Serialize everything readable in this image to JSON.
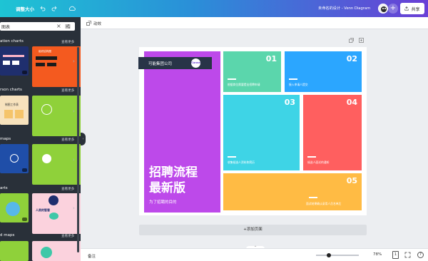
{
  "topbar": {
    "resize_label": "调整大小",
    "doc_title": "未命名的设计 - Venn Diagram",
    "share_label": "共享"
  },
  "sidebar": {
    "search_query": "图表",
    "sections": [
      {
        "title": "ation charts",
        "more": "查看更多"
      },
      {
        "title": "rson charts",
        "more": "查看更多"
      },
      {
        "title": "maps",
        "more": "查看更多"
      },
      {
        "title": "arts",
        "more": "查看更多"
      },
      {
        "title": "d maps",
        "more": "查看更多"
      }
    ],
    "thumb_texts": {
      "orgchart": "组织结构图",
      "compare": "制图工作表",
      "people": "人类的智慧"
    }
  },
  "canvas_toolbar": {
    "animate_label": "动效"
  },
  "slide": {
    "company": "可能集团公司",
    "logo_text": "Canva",
    "title_lines": [
      "招聘流程",
      "最新版"
    ],
    "subtitle": "为了招聘的目的",
    "tiles": [
      {
        "num": "01",
        "text": "根据岗位需要提出招聘申请"
      },
      {
        "num": "02",
        "text": "接入申请人提交"
      },
      {
        "num": "03",
        "text": "收集候选人资料和简历"
      },
      {
        "num": "04",
        "text": "候选人面试的通知"
      },
      {
        "num": "05",
        "text": "面试结果确认录用人员名单后"
      }
    ],
    "colors": {
      "purple": "#bd49ea",
      "tile1": "#5bd6ac",
      "tile2": "#2ba6ff",
      "tile3": "#3ed4e6",
      "tile4": "#ff5f5f",
      "tile5": "#ffbb44"
    }
  },
  "add_page_label": "+添加页面",
  "bottombar": {
    "notes_label": "备注",
    "zoom": "78%",
    "zoom_fraction": 0.3,
    "page_count": "1",
    "help_label": "?"
  }
}
